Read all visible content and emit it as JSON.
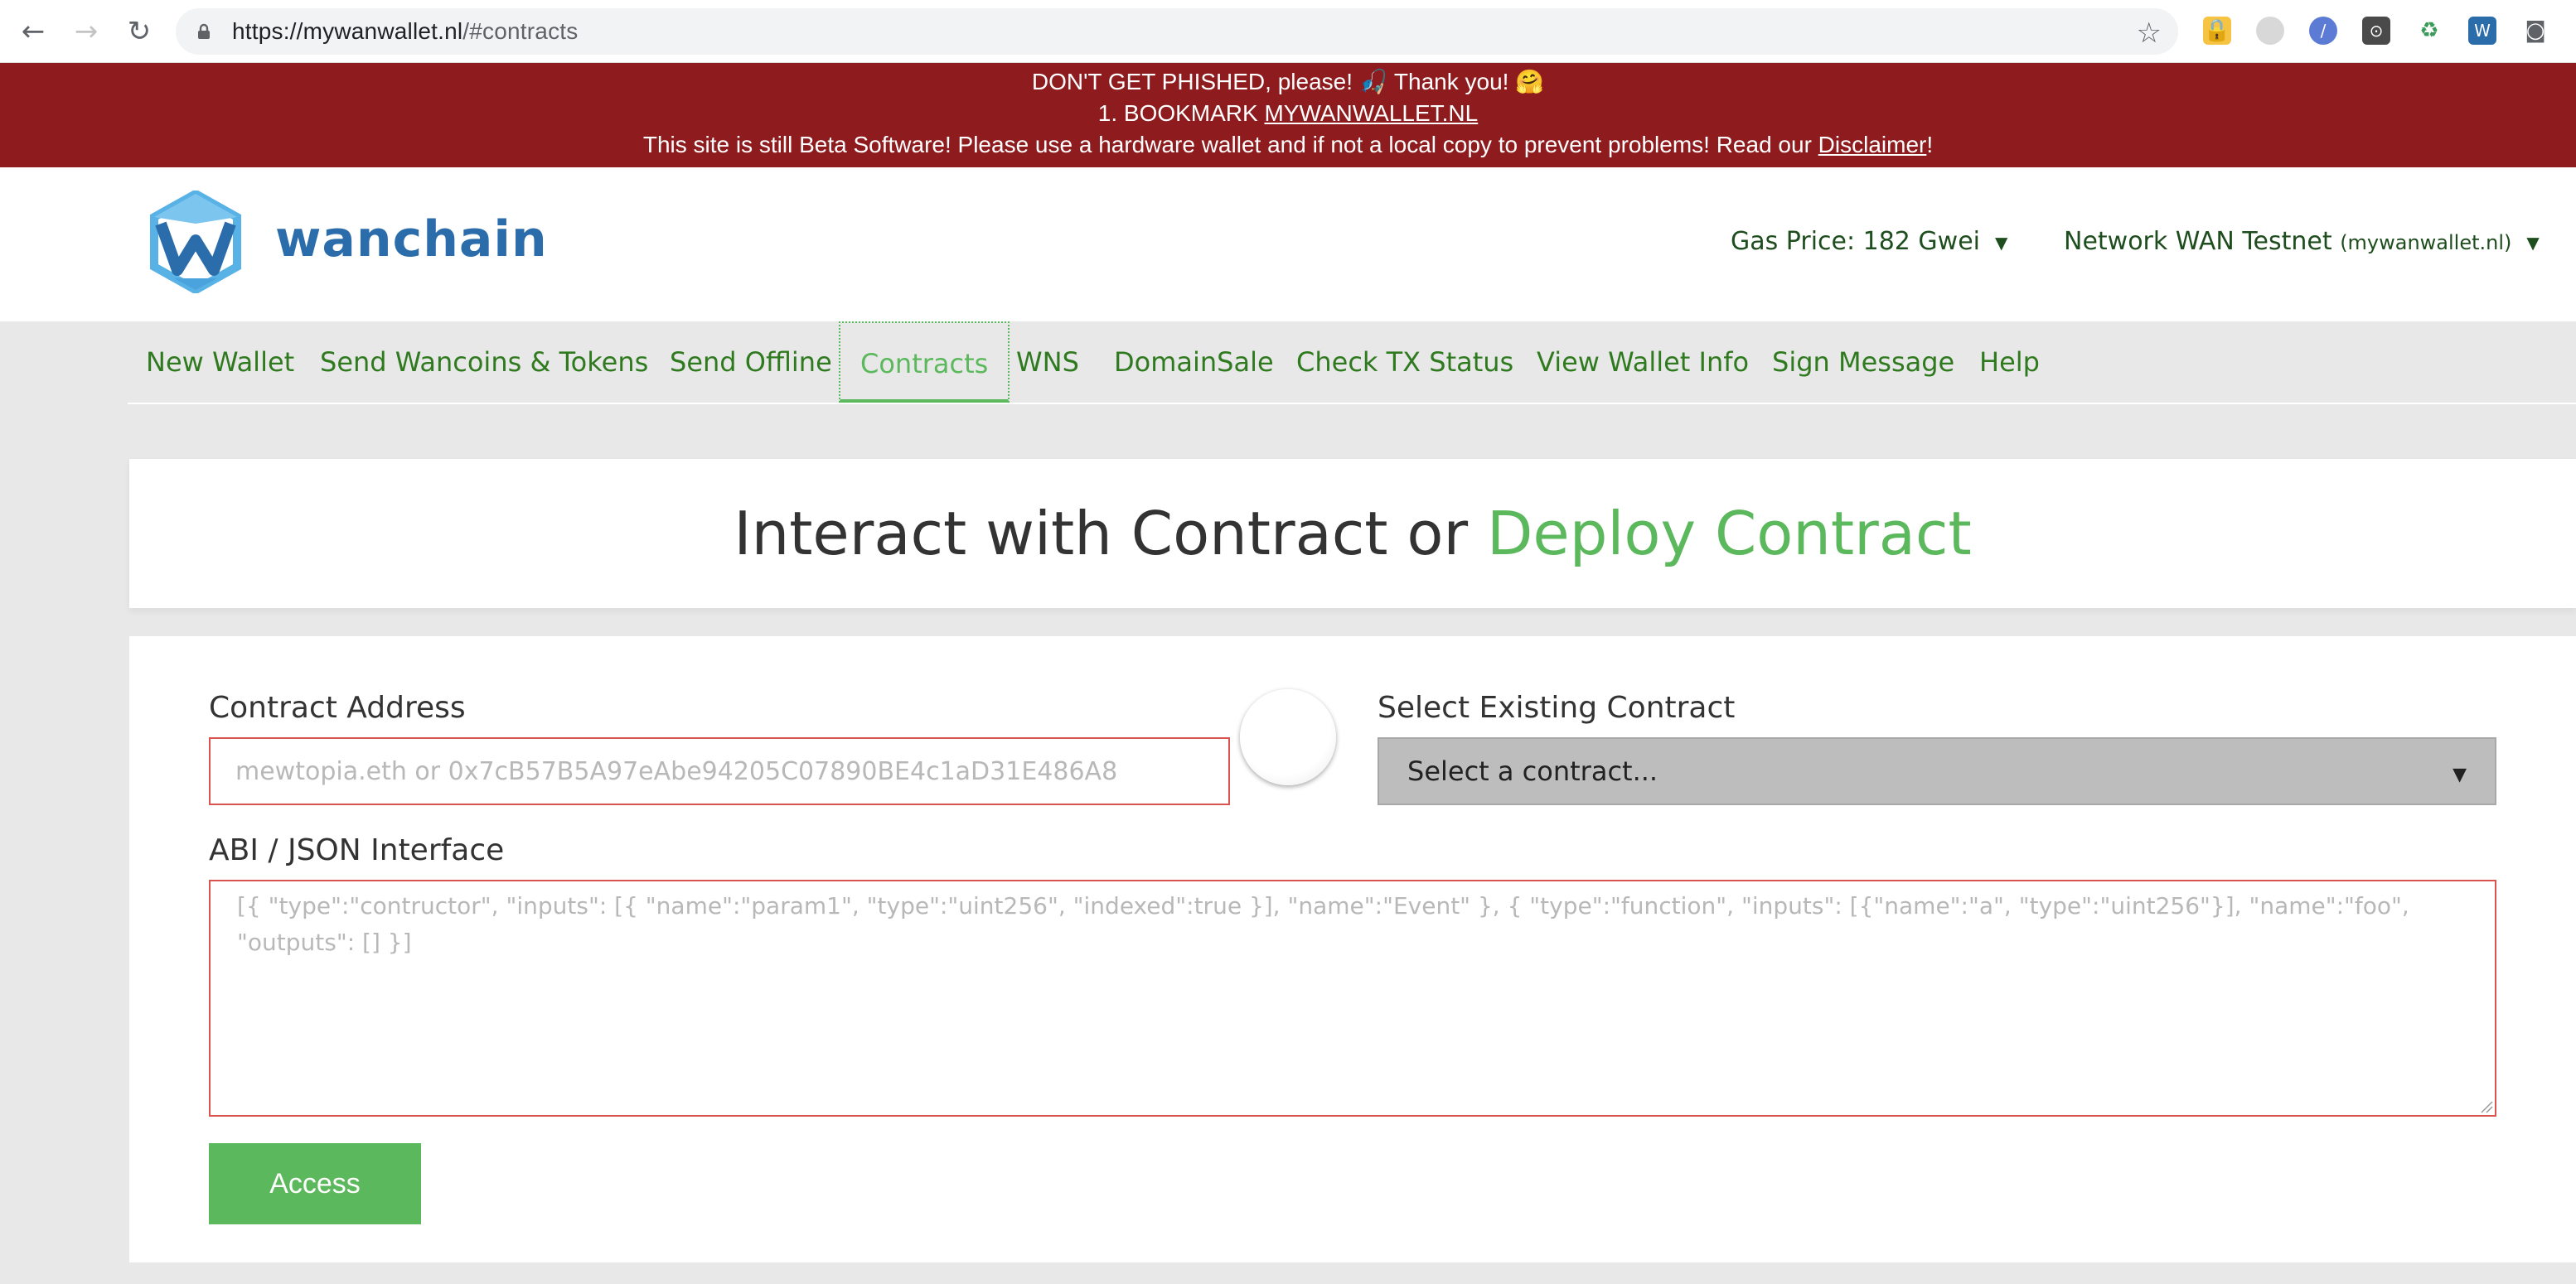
{
  "browser": {
    "url_host": "https://mywanwallet.nl",
    "url_path": "/#contracts"
  },
  "warning": {
    "line1": "DON'T GET PHISHED, please! 🎣 Thank you! 🤗",
    "line2_prefix": "1. BOOKMARK ",
    "line2_link": "MYWANWALLET.NL ",
    "line3_prefix": "This site is still Beta Software! Please use a hardware wallet and if not a local copy to prevent problems! Read our ",
    "line3_link": "Disclaimer",
    "line3_suffix": "!"
  },
  "header": {
    "logo_text": "wanchain",
    "gas_price": "Gas Price: 182 Gwei",
    "network": "Network WAN Testnet",
    "network_host": "(mywanwallet.nl)"
  },
  "tabs": [
    {
      "label": "New Wallet"
    },
    {
      "label": "Send Wancoins & Tokens"
    },
    {
      "label": "Send Offline"
    },
    {
      "label": "Contracts"
    },
    {
      "label": "WNS"
    },
    {
      "label": "DomainSale"
    },
    {
      "label": "Check TX Status"
    },
    {
      "label": "View Wallet Info"
    },
    {
      "label": "Sign Message"
    },
    {
      "label": "Help"
    }
  ],
  "title": {
    "interact": "Interact with Contract",
    "or": " or ",
    "deploy": "Deploy Contract"
  },
  "form": {
    "contract_address_label": "Contract Address",
    "contract_address_placeholder": "mewtopia.eth or 0x7cB57B5A97eAbe94205C07890BE4c1aD31E486A8",
    "select_label": "Select Existing Contract",
    "select_value": "Select a contract...",
    "abi_label": "ABI / JSON Interface",
    "abi_placeholder": "[{ \"type\":\"contructor\", \"inputs\": [{ \"name\":\"param1\", \"type\":\"uint256\", \"indexed\":true }], \"name\":\"Event\" }, { \"type\":\"function\", \"inputs\": [{\"name\":\"a\", \"type\":\"uint256\"}], \"name\":\"foo\", \"outputs\": [] }]",
    "access_button": "Access"
  },
  "colors": {
    "banner": "#8e1c1f",
    "accent_green": "#5cb85c",
    "nav_green": "#2f7a1f",
    "logo_blue": "#2b6cab",
    "error_red": "#d9534f"
  }
}
